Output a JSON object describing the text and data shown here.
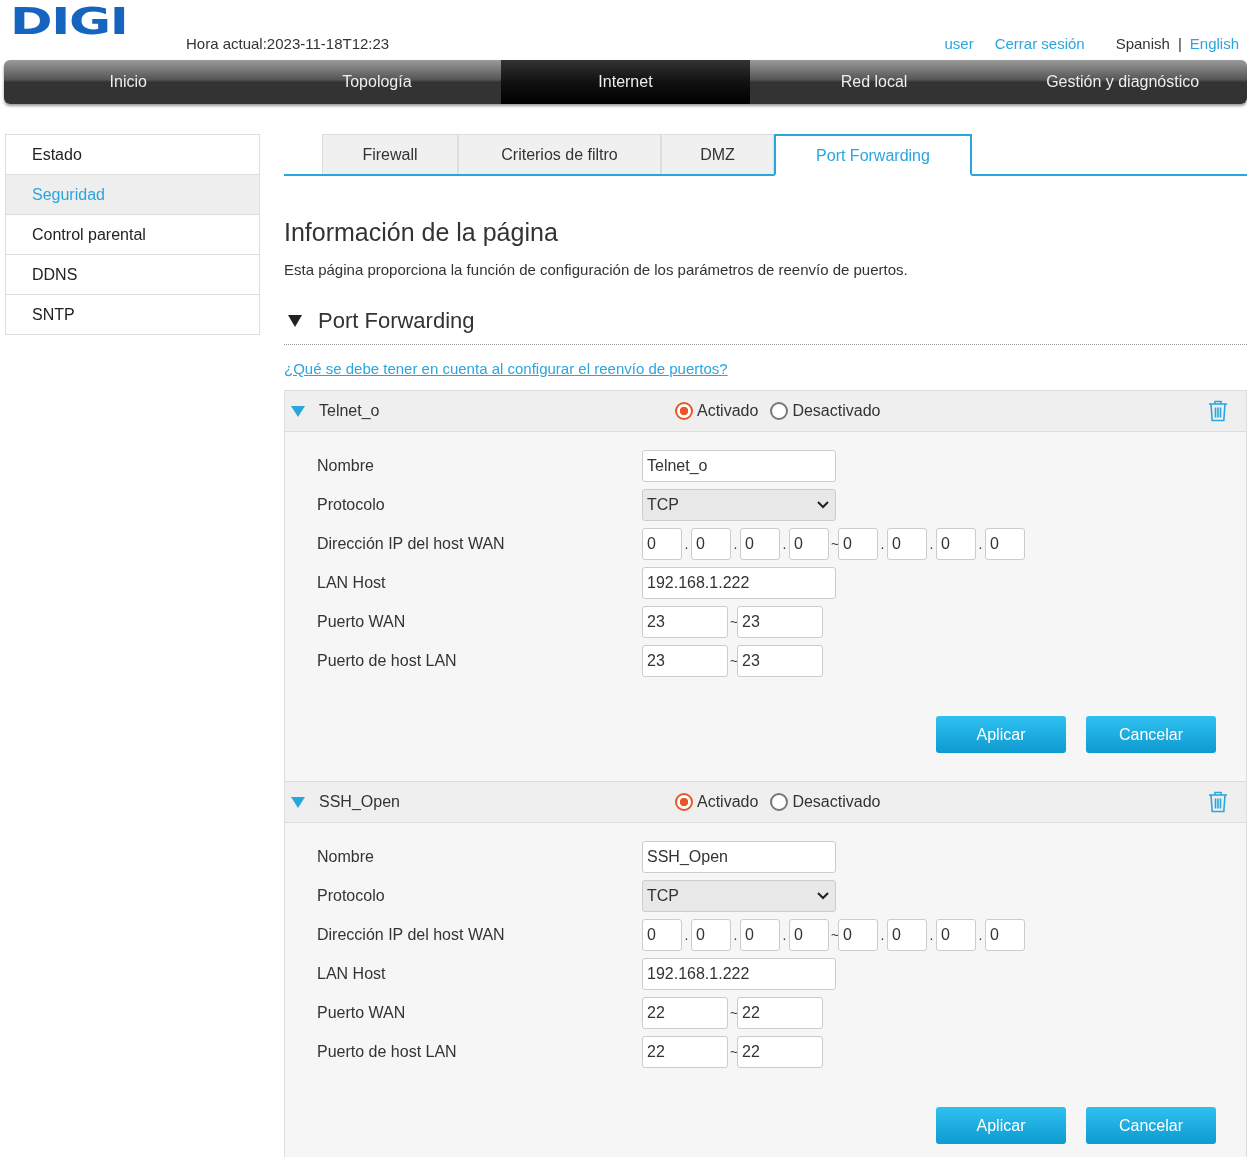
{
  "header": {
    "logo": "DIGI",
    "time": "Hora actual:2023-11-18T12:23",
    "user": "user",
    "logout": "Cerrar sesión",
    "languages": [
      {
        "label": "Spanish",
        "selected": true
      },
      {
        "label": "English",
        "selected": false
      }
    ],
    "language_separator": "|"
  },
  "nav": [
    {
      "label": "Inicio",
      "selected": false
    },
    {
      "label": "Topología",
      "selected": false
    },
    {
      "label": "Internet",
      "selected": true
    },
    {
      "label": "Red local",
      "selected": false
    },
    {
      "label": "Gestión y diagnóstico",
      "selected": false
    }
  ],
  "sidebar": {
    "items": [
      {
        "label": "Estado",
        "selected": false
      },
      {
        "label": "Seguridad",
        "selected": true
      },
      {
        "label": "Control parental",
        "selected": false
      },
      {
        "label": "DDNS",
        "selected": false
      },
      {
        "label": "SNTP",
        "selected": false
      }
    ]
  },
  "tabs": [
    {
      "label": "Firewall",
      "selected": false
    },
    {
      "label": "Criterios de filtro",
      "selected": false
    },
    {
      "label": "DMZ",
      "selected": false
    },
    {
      "label": "Port Forwarding",
      "selected": true
    }
  ],
  "page": {
    "title": "Información de la página",
    "description": "Esta página proporciona la función de configuración de los parámetros de reenvío de puertos.",
    "section": "Port Forwarding",
    "section_expanded": true,
    "help_link": "¿Qué se debe tener en cuenta al configurar el reenvío de puertos?"
  },
  "rules": [
    {
      "name": "Telnet_o",
      "expanded": true,
      "options": [
        {
          "label": "Activado",
          "selected": true
        },
        {
          "label": "Desactivado",
          "selected": false
        }
      ],
      "fields": [
        {
          "kind": "text",
          "label": "Nombre",
          "value": "Telnet_o"
        },
        {
          "kind": "select",
          "label": "Protocolo",
          "value": "TCP"
        },
        {
          "kind": "parts",
          "label": "Dirección IP del host WAN",
          "parts": [
            "0",
            ".",
            "0",
            ".",
            "0",
            ".",
            "0",
            "~",
            "0",
            ".",
            "0",
            ".",
            "0",
            ".",
            "0"
          ]
        },
        {
          "kind": "text",
          "label": "LAN Host",
          "value": "192.168.1.222"
        },
        {
          "kind": "parts",
          "label": "Puerto WAN",
          "parts": [
            "23",
            "~",
            "23"
          ]
        },
        {
          "kind": "parts",
          "label": "Puerto de host LAN",
          "parts": [
            "23",
            "~",
            "23"
          ]
        }
      ],
      "buttons": [
        "Aplicar",
        "Cancelar"
      ]
    },
    {
      "name": "SSH_Open",
      "expanded": true,
      "options": [
        {
          "label": "Activado",
          "selected": true
        },
        {
          "label": "Desactivado",
          "selected": false
        }
      ],
      "fields": [
        {
          "kind": "text",
          "label": "Nombre",
          "value": "SSH_Open"
        },
        {
          "kind": "select",
          "label": "Protocolo",
          "value": "TCP"
        },
        {
          "kind": "parts",
          "label": "Dirección IP del host WAN",
          "parts": [
            "0",
            ".",
            "0",
            ".",
            "0",
            ".",
            "0",
            "~",
            "0",
            ".",
            "0",
            ".",
            "0",
            ".",
            "0"
          ]
        },
        {
          "kind": "text",
          "label": "LAN Host",
          "value": "192.168.1.222"
        },
        {
          "kind": "parts",
          "label": "Puerto WAN",
          "parts": [
            "22",
            "~",
            "22"
          ]
        },
        {
          "kind": "parts",
          "label": "Puerto de host LAN",
          "parts": [
            "22",
            "~",
            "22"
          ]
        }
      ],
      "buttons": [
        "Aplicar",
        "Cancelar"
      ]
    }
  ]
}
